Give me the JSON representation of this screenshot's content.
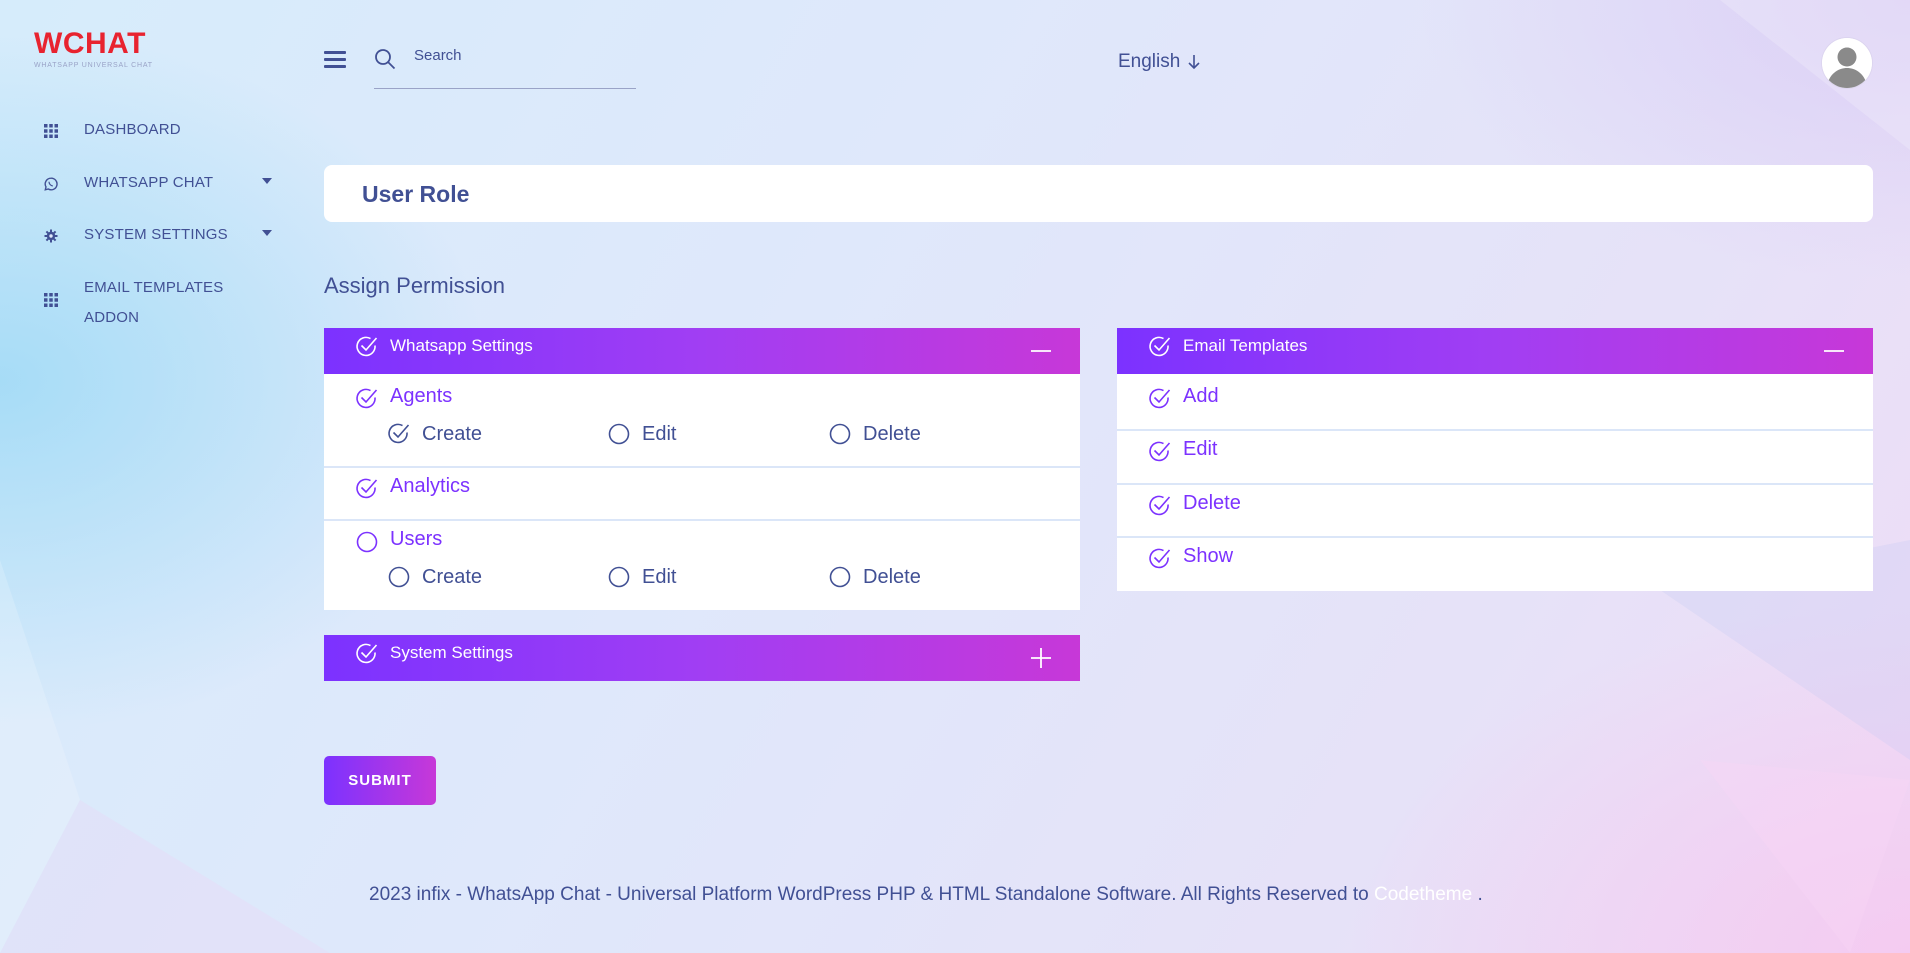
{
  "logo": {
    "title": "WCHAT",
    "subtitle": "WHATSAPP UNIVERSAL CHAT"
  },
  "sidebar": {
    "items": [
      {
        "label": "DASHBOARD",
        "icon": "grid-icon"
      },
      {
        "label": "WHATSAPP CHAT",
        "icon": "whatsapp-icon",
        "has_submenu": true
      },
      {
        "label": "SYSTEM SETTINGS",
        "icon": "gear-icon",
        "has_submenu": true
      },
      {
        "label_line1": "EMAIL TEMPLATES",
        "label_line2": "ADDON",
        "icon": "grid-icon"
      }
    ]
  },
  "header": {
    "search_placeholder": "Search",
    "language": "English"
  },
  "page": {
    "title": "User Role",
    "section_title": "Assign Permission"
  },
  "permissions": {
    "whatsapp_settings": {
      "title": "Whatsapp Settings",
      "checked": true,
      "expanded": true,
      "rows": [
        {
          "label": "Agents",
          "checked": true,
          "subs": [
            {
              "label": "Create",
              "checked": true
            },
            {
              "label": "Edit",
              "checked": false
            },
            {
              "label": "Delete",
              "checked": false
            }
          ]
        },
        {
          "label": "Analytics",
          "checked": true
        },
        {
          "label": "Users",
          "checked": false,
          "subs": [
            {
              "label": "Create",
              "checked": false
            },
            {
              "label": "Edit",
              "checked": false
            },
            {
              "label": "Delete",
              "checked": false
            }
          ]
        }
      ]
    },
    "system_settings": {
      "title": "System Settings",
      "checked": true,
      "expanded": false
    },
    "email_templates": {
      "title": "Email Templates",
      "checked": true,
      "expanded": true,
      "rows": [
        {
          "label": "Add",
          "checked": true
        },
        {
          "label": "Edit",
          "checked": true
        },
        {
          "label": "Delete",
          "checked": true
        },
        {
          "label": "Show",
          "checked": true
        }
      ]
    }
  },
  "submit_label": "SUBMIT",
  "footer": {
    "text": "2023 infix - WhatsApp Chat - Universal Platform WordPress PHP & HTML Standalone Software. All Rights Reserved to",
    "link": "Codetheme",
    "suffix": " ."
  },
  "colors": {
    "accent": "#7c32ff",
    "accent_end": "#c738d8",
    "text": "#415094",
    "logo": "#e8232f"
  }
}
